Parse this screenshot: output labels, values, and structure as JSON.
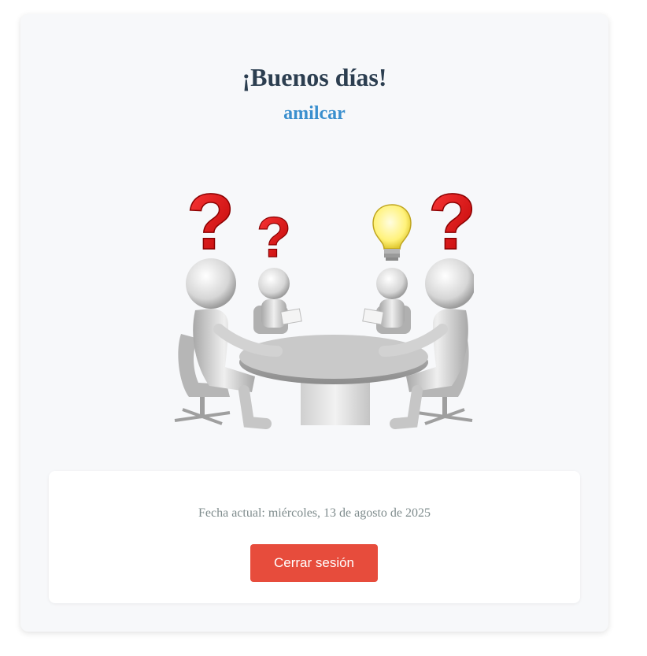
{
  "greeting": {
    "title": "¡Buenos días!",
    "username": "amilcar"
  },
  "illustration": {
    "icon": "meeting-table-people-icon",
    "description_icon": "question-marks-and-lightbulb"
  },
  "info": {
    "date_label": "Fecha actual:",
    "date_value": "miércoles, 13 de agosto de 2025",
    "logout_label": "Cerrar sesión"
  },
  "colors": {
    "title": "#2c3e50",
    "username": "#3a8fce",
    "logout_button": "#e74c3c",
    "date_text": "#7f8c8d",
    "card_bg": "#f7f8fa"
  }
}
